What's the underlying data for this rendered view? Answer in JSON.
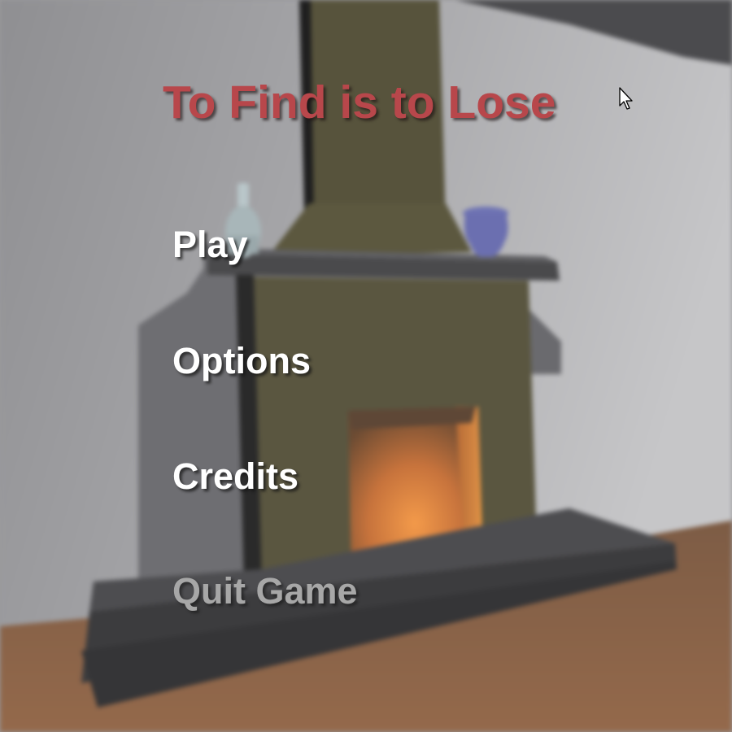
{
  "title": "To Find is to Lose",
  "menu": {
    "items": [
      {
        "label": "Play",
        "state": "normal"
      },
      {
        "label": "Options",
        "state": "normal"
      },
      {
        "label": "Credits",
        "state": "normal"
      },
      {
        "label": "Quit Game",
        "state": "dimmed"
      }
    ]
  },
  "colors": {
    "title": "#b8474b",
    "menu_item": "#ffffff",
    "menu_item_dimmed": "#a7a7a7",
    "wall": "#a2a2a4",
    "floor": "#8a6347",
    "chimney": "#57533c",
    "fire_glow": "#e07a2a"
  },
  "icons": {
    "cursor": "mouse-pointer-icon"
  }
}
